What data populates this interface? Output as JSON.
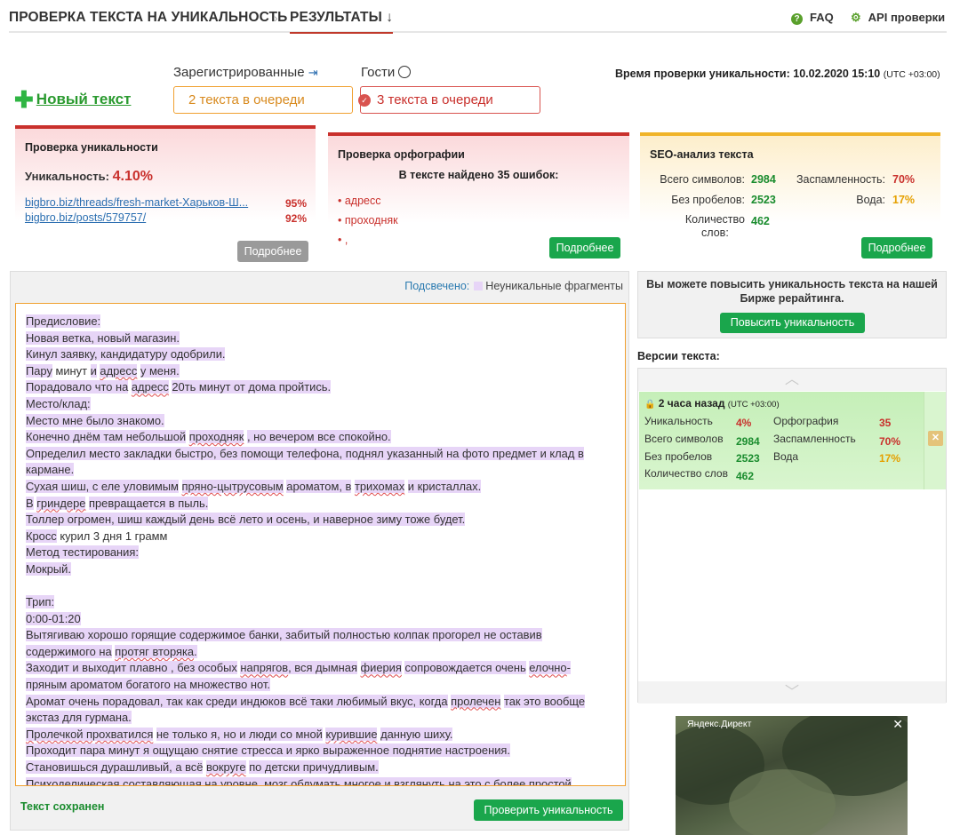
{
  "nav": {
    "crumb1": "ПРОВЕРКА ТЕКСТА НА УНИКАЛЬНОСТЬ",
    "crumb2": "РЕЗУЛЬТАТЫ ↓",
    "faq": "FAQ",
    "api": "API проверки"
  },
  "queue": {
    "new_text": "Новый текст",
    "registered_label": "Зарегистрированные",
    "guests_label": "Гости",
    "registered_value": "2 текста в очереди",
    "guests_value": "3 текста в очереди",
    "check_time_label": "Время проверки уникальности: 10.02.2020 15:10",
    "check_time_tz": "(UTC +03:00)"
  },
  "uniq_card": {
    "title": "Проверка уникальности",
    "label": "Уникальность:",
    "value": "4.10%",
    "sources": [
      {
        "url": "bigbro.biz/threads/fresh-market-Харьков-Ш...",
        "pct": "95%"
      },
      {
        "url": "bigbro.biz/posts/579757/",
        "pct": "92%"
      }
    ],
    "more": "Подробнее"
  },
  "orth_card": {
    "title": "Проверка орфографии",
    "summary": "В тексте найдено 35 ошибок:",
    "errors": [
      "• адресс",
      "• проходняк",
      "• ,"
    ],
    "more": "Подробнее"
  },
  "seo_card": {
    "title": "SEO-анализ текста",
    "total_label": "Всего символов:",
    "total_value": "2984",
    "nospace_label": "Без пробелов:",
    "nospace_value": "2523",
    "words_label1": "Количество",
    "words_label2": "слов:",
    "words_value": "462",
    "spam_label": "Заспамленность:",
    "spam_value": "70%",
    "water_label": "Вода:",
    "water_value": "17%",
    "more": "Подробнее"
  },
  "editor": {
    "legend_label": "Подсвечено:",
    "legend_text": "Неуникальные фрагменты",
    "saved": "Текст сохранен",
    "check_button": "Проверить уникальность"
  },
  "promo": {
    "text": "Вы можете повысить уникальность текста на нашей Бирже рерайтинга.",
    "button": "Повысить уникальность"
  },
  "versions": {
    "title": "Версии текста:",
    "time": "2 часа назад",
    "tz": "(UTC +03:00)",
    "uniq_label": "Уникальность",
    "uniq_value": "4%",
    "total_label": "Всего символов",
    "total_value": "2984",
    "nospace_label": "Без пробелов",
    "nospace_value": "2523",
    "words_label": "Количество слов",
    "words_value": "462",
    "orth_label": "Орфография",
    "orth_value": "35",
    "spam_label": "Заспамленность",
    "spam_value": "70%",
    "water_label": "Вода",
    "water_value": "17%"
  },
  "ad": {
    "label": "Яндекс.Директ"
  },
  "colors": {
    "accent_red": "#c9302c",
    "accent_green": "#1aa64c",
    "highlight": "#e7d5f7",
    "orange": "#f0a030"
  }
}
